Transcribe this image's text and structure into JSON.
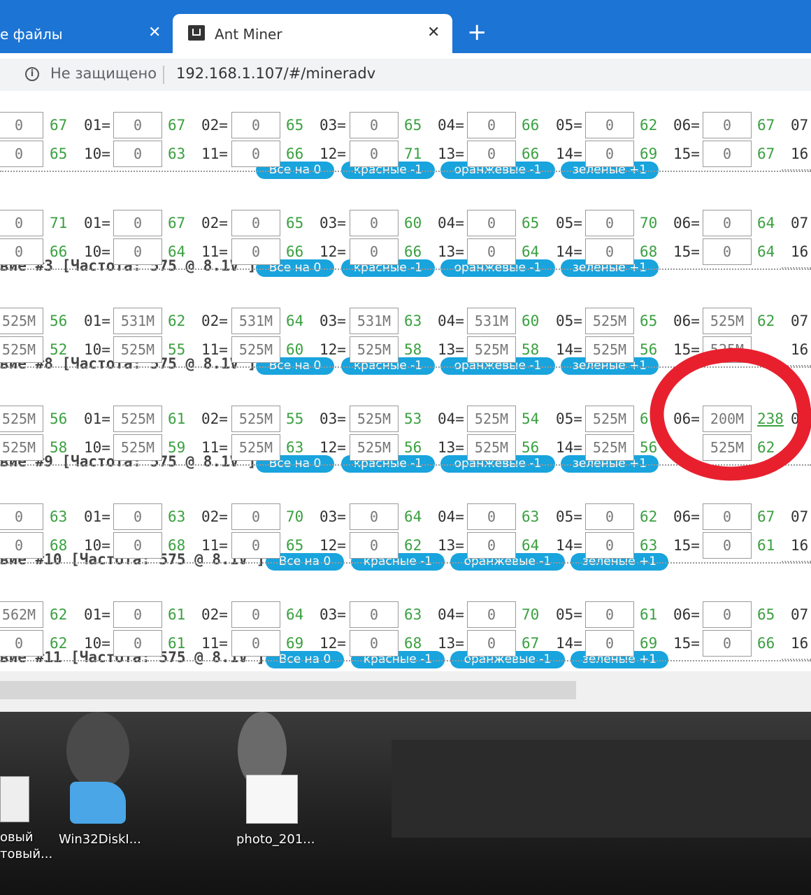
{
  "browser": {
    "tabs": [
      {
        "label": "е файлы"
      },
      {
        "label": "Ant Miner"
      }
    ],
    "close_glyph": "✕",
    "new_tab_glyph": "+",
    "security_label": "Не защищено",
    "url": "192.168.1.107/#/mineradv"
  },
  "buttons": {
    "all_zero": "Все на 0",
    "red_minus": "красные -1",
    "orange_minus": "оранжевые -1",
    "green_plus": "зеленые +1"
  },
  "sections": [
    {
      "title": "",
      "rows": [
        {
          "lead_value": "0",
          "lead_temp": "67",
          "cells": [
            {
              "label": "01=",
              "value": "0",
              "temp": "67"
            },
            {
              "label": "02=",
              "value": "0",
              "temp": "65"
            },
            {
              "label": "03=",
              "value": "0",
              "temp": "65"
            },
            {
              "label": "04=",
              "value": "0",
              "temp": "66"
            },
            {
              "label": "05=",
              "value": "0",
              "temp": "62"
            },
            {
              "label": "06=",
              "value": "0",
              "temp": "67"
            }
          ],
          "tail_label": "07"
        },
        {
          "lead_value": "0",
          "lead_temp": "65",
          "cells": [
            {
              "label": "10=",
              "value": "0",
              "temp": "63"
            },
            {
              "label": "11=",
              "value": "0",
              "temp": "66"
            },
            {
              "label": "12=",
              "value": "0",
              "temp": "71"
            },
            {
              "label": "13=",
              "value": "0",
              "temp": "66"
            },
            {
              "label": "14=",
              "value": "0",
              "temp": "69"
            },
            {
              "label": "15=",
              "value": "0",
              "temp": "67"
            }
          ],
          "tail_label": "16"
        }
      ]
    },
    {
      "title": "вие #3 [Частота: 575 @ 8.1V ]",
      "rows": [
        {
          "lead_value": "0",
          "lead_temp": "71",
          "cells": [
            {
              "label": "01=",
              "value": "0",
              "temp": "67"
            },
            {
              "label": "02=",
              "value": "0",
              "temp": "65"
            },
            {
              "label": "03=",
              "value": "0",
              "temp": "60"
            },
            {
              "label": "04=",
              "value": "0",
              "temp": "65"
            },
            {
              "label": "05=",
              "value": "0",
              "temp": "70"
            },
            {
              "label": "06=",
              "value": "0",
              "temp": "64"
            }
          ],
          "tail_label": "07"
        },
        {
          "lead_value": "0",
          "lead_temp": "66",
          "cells": [
            {
              "label": "10=",
              "value": "0",
              "temp": "64"
            },
            {
              "label": "11=",
              "value": "0",
              "temp": "66"
            },
            {
              "label": "12=",
              "value": "0",
              "temp": "66"
            },
            {
              "label": "13=",
              "value": "0",
              "temp": "64"
            },
            {
              "label": "14=",
              "value": "0",
              "temp": "68"
            },
            {
              "label": "15=",
              "value": "0",
              "temp": "64"
            }
          ],
          "tail_label": "16"
        }
      ]
    },
    {
      "title": "вие #8 [Частота: 575 @ 8.1V ]",
      "rows": [
        {
          "lead_value": "525M",
          "lead_temp": "56",
          "cells": [
            {
              "label": "01=",
              "value": "531M",
              "temp": "62"
            },
            {
              "label": "02=",
              "value": "531M",
              "temp": "64"
            },
            {
              "label": "03=",
              "value": "531M",
              "temp": "63"
            },
            {
              "label": "04=",
              "value": "531M",
              "temp": "60"
            },
            {
              "label": "05=",
              "value": "525M",
              "temp": "65"
            },
            {
              "label": "06=",
              "value": "525M",
              "temp": "62"
            }
          ],
          "tail_label": "07"
        },
        {
          "lead_value": "525M",
          "lead_temp": "52",
          "cells": [
            {
              "label": "10=",
              "value": "525M",
              "temp": "55"
            },
            {
              "label": "11=",
              "value": "525M",
              "temp": "60"
            },
            {
              "label": "12=",
              "value": "525M",
              "temp": "58"
            },
            {
              "label": "13=",
              "value": "525M",
              "temp": "58"
            },
            {
              "label": "14=",
              "value": "525M",
              "temp": "56"
            },
            {
              "label": "15=",
              "value": "525M",
              "temp": ""
            }
          ],
          "tail_label": "16"
        }
      ]
    },
    {
      "title": "вие #9 [Частота: 575 @ 8.1V ]",
      "rows": [
        {
          "lead_value": "525M",
          "lead_temp": "56",
          "cells": [
            {
              "label": "01=",
              "value": "525M",
              "temp": "61"
            },
            {
              "label": "02=",
              "value": "525M",
              "temp": "55"
            },
            {
              "label": "03=",
              "value": "525M",
              "temp": "53"
            },
            {
              "label": "04=",
              "value": "525M",
              "temp": "54"
            },
            {
              "label": "05=",
              "value": "525M",
              "temp": "6"
            },
            {
              "label": "06=",
              "value": "200M",
              "temp": "238"
            }
          ],
          "tail_label": "0"
        },
        {
          "lead_value": "525M",
          "lead_temp": "58",
          "cells": [
            {
              "label": "10=",
              "value": "525M",
              "temp": "59"
            },
            {
              "label": "11=",
              "value": "525M",
              "temp": "63"
            },
            {
              "label": "12=",
              "value": "525M",
              "temp": "56"
            },
            {
              "label": "13=",
              "value": "525M",
              "temp": "56"
            },
            {
              "label": "14=",
              "value": "525M",
              "temp": "56"
            },
            {
              "label": "",
              "value": "525M",
              "temp": "62"
            }
          ],
          "tail_label": "1"
        }
      ]
    },
    {
      "title": "вие #10 [Частота: 575 @ 8.1V ]",
      "rows": [
        {
          "lead_value": "0",
          "lead_temp": "63",
          "cells": [
            {
              "label": "01=",
              "value": "0",
              "temp": "63"
            },
            {
              "label": "02=",
              "value": "0",
              "temp": "70"
            },
            {
              "label": "03=",
              "value": "0",
              "temp": "64"
            },
            {
              "label": "04=",
              "value": "0",
              "temp": "63"
            },
            {
              "label": "05=",
              "value": "0",
              "temp": "62"
            },
            {
              "label": "06=",
              "value": "0",
              "temp": "67"
            }
          ],
          "tail_label": "07"
        },
        {
          "lead_value": "0",
          "lead_temp": "68",
          "cells": [
            {
              "label": "10=",
              "value": "0",
              "temp": "68"
            },
            {
              "label": "11=",
              "value": "0",
              "temp": "65"
            },
            {
              "label": "12=",
              "value": "0",
              "temp": "62"
            },
            {
              "label": "13=",
              "value": "0",
              "temp": "64"
            },
            {
              "label": "14=",
              "value": "0",
              "temp": "63"
            },
            {
              "label": "15=",
              "value": "0",
              "temp": "61"
            }
          ],
          "tail_label": "16"
        }
      ]
    },
    {
      "title": "вие #11 [Частота: 575 @ 8.1V ]",
      "rows": [
        {
          "lead_value": "562M",
          "lead_temp": "62",
          "cells": [
            {
              "label": "01=",
              "value": "0",
              "temp": "61"
            },
            {
              "label": "02=",
              "value": "0",
              "temp": "64"
            },
            {
              "label": "03=",
              "value": "0",
              "temp": "63"
            },
            {
              "label": "04=",
              "value": "0",
              "temp": "70"
            },
            {
              "label": "05=",
              "value": "0",
              "temp": "61"
            },
            {
              "label": "06=",
              "value": "0",
              "temp": "65"
            }
          ],
          "tail_label": "07"
        },
        {
          "lead_value": "0",
          "lead_temp": "62",
          "cells": [
            {
              "label": "10=",
              "value": "0",
              "temp": "61"
            },
            {
              "label": "11=",
              "value": "0",
              "temp": "69"
            },
            {
              "label": "12=",
              "value": "0",
              "temp": "68"
            },
            {
              "label": "13=",
              "value": "0",
              "temp": "67"
            },
            {
              "label": "14=",
              "value": "0",
              "temp": "69"
            },
            {
              "label": "15=",
              "value": "0",
              "temp": "66"
            }
          ],
          "tail_label": "16"
        }
      ]
    }
  ],
  "desktop": {
    "icons": [
      {
        "label": "овый\nтовый..."
      },
      {
        "label": "Win32DiskI..."
      },
      {
        "label": "photo_201..."
      }
    ]
  },
  "colors": {
    "tab_bar": "#1c74d4",
    "pill": "#19a4dd",
    "temp_green": "#3aa040",
    "annotation_red": "#e8202e"
  }
}
